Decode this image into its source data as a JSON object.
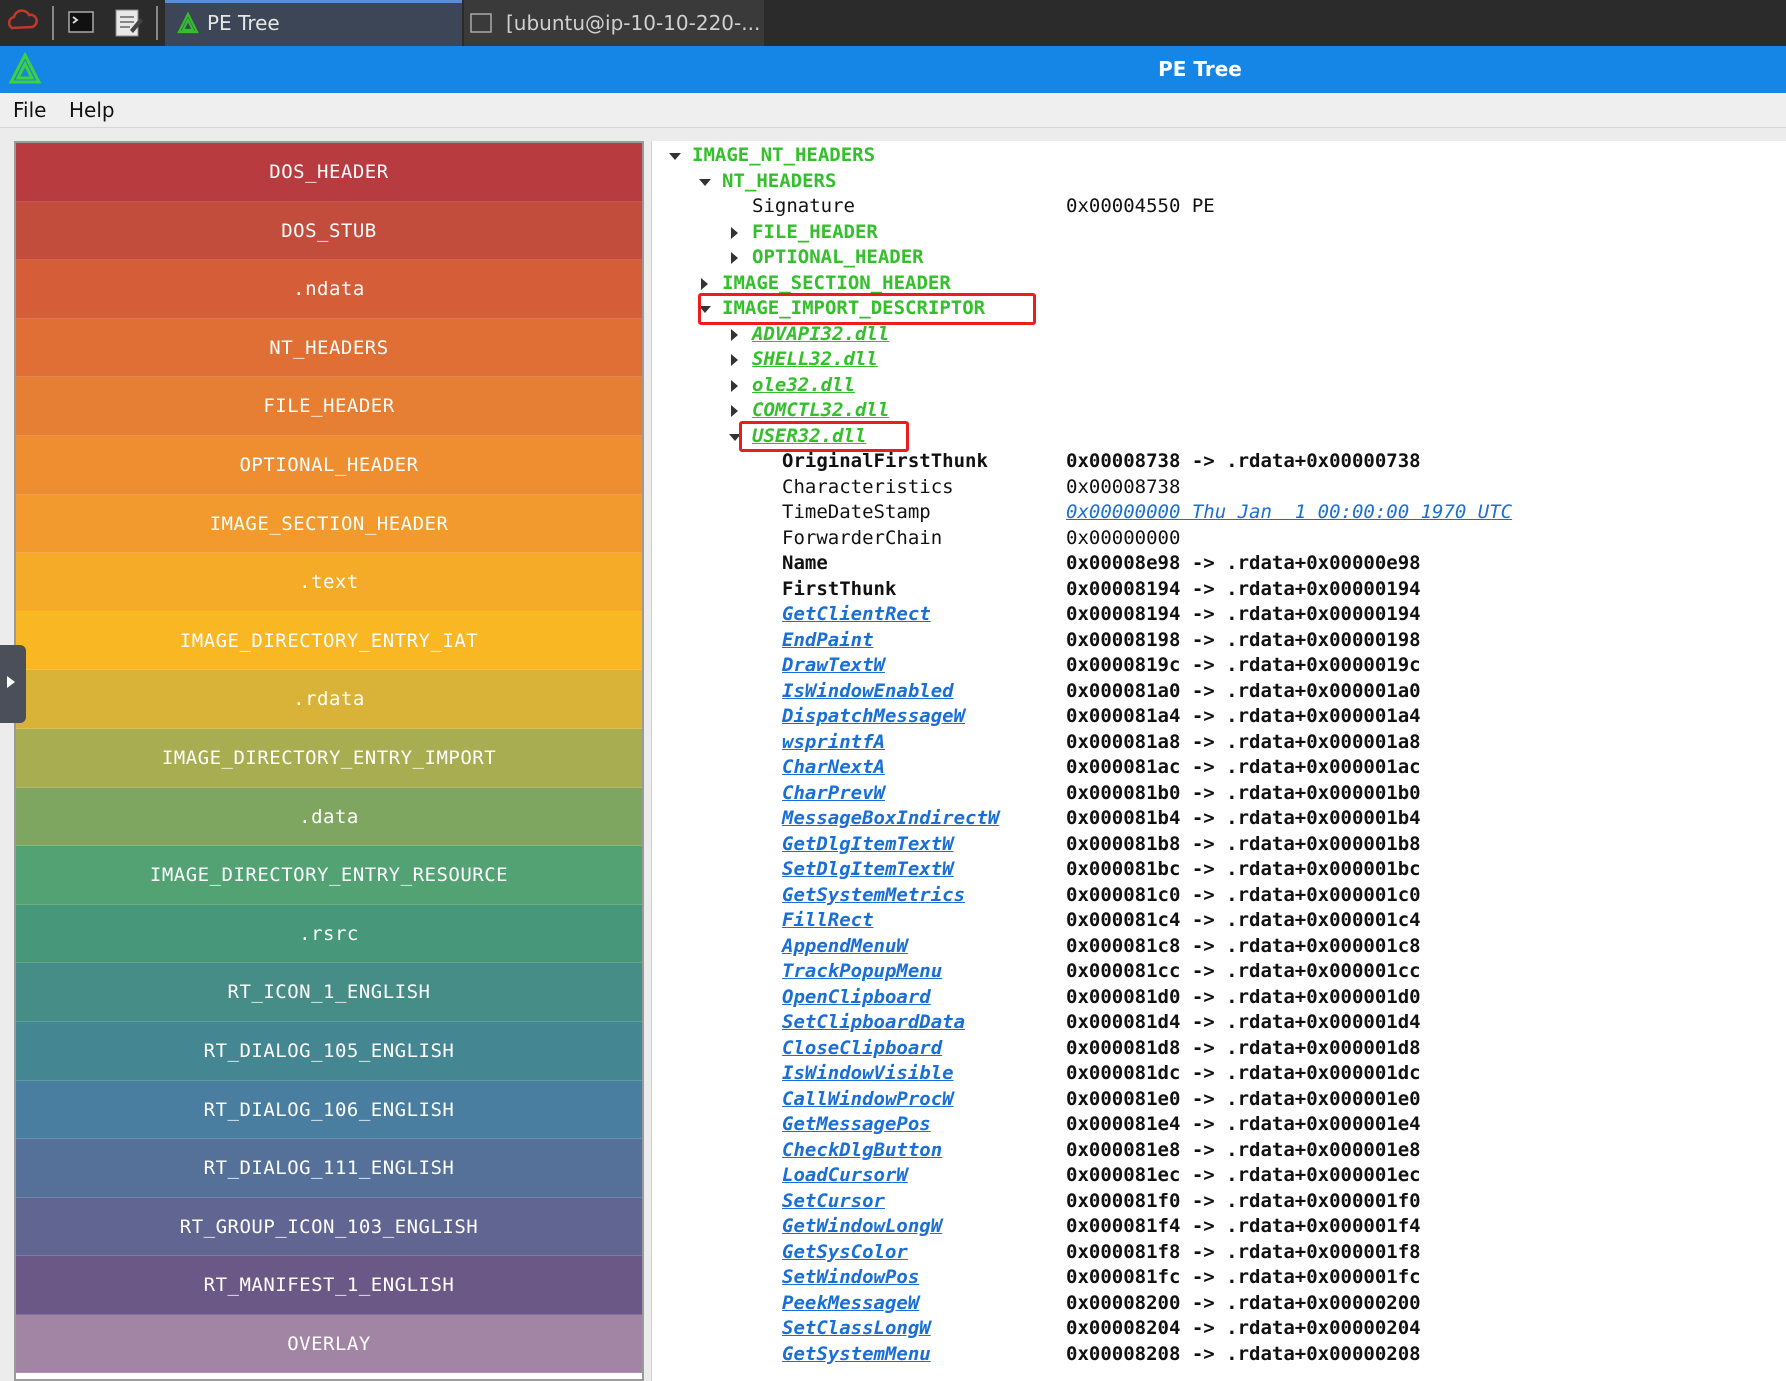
{
  "taskbar": {
    "tabs": [
      {
        "label": "PE Tree"
      },
      {
        "label": "[ubuntu@ip-10-10-220-..."
      }
    ]
  },
  "window": {
    "title": "PE Tree"
  },
  "menu": [
    {
      "label": "File"
    },
    {
      "label": "Help"
    }
  ],
  "sections": [
    {
      "label": "DOS_HEADER",
      "color": "#b83b40"
    },
    {
      "label": "DOS_STUB",
      "color": "#c24d3c"
    },
    {
      "label": ".ndata",
      "color": "#d55d38"
    },
    {
      "label": "NT_HEADERS",
      "color": "#df6f35"
    },
    {
      "label": "FILE_HEADER",
      "color": "#e67f33"
    },
    {
      "label": "OPTIONAL_HEADER",
      "color": "#ee8e30"
    },
    {
      "label": "IMAGE_SECTION_HEADER",
      "color": "#f29a2d"
    },
    {
      "label": ".text",
      "color": "#f6ab28"
    },
    {
      "label": "IMAGE_DIRECTORY_ENTRY_IAT",
      "color": "#f8b723"
    },
    {
      "label": ".rdata",
      "color": "#d8b338"
    },
    {
      "label": "IMAGE_DIRECTORY_ENTRY_IMPORT",
      "color": "#a9ad52"
    },
    {
      "label": ".data",
      "color": "#7fa661"
    },
    {
      "label": "IMAGE_DIRECTORY_ENTRY_RESOURCE",
      "color": "#52a274"
    },
    {
      "label": ".rsrc",
      "color": "#47977b"
    },
    {
      "label": "RT_ICON_1_ENGLISH",
      "color": "#458d86"
    },
    {
      "label": "RT_DIALOG_105_ENGLISH",
      "color": "#458693"
    },
    {
      "label": "RT_DIALOG_106_ENGLISH",
      "color": "#4a7ea0"
    },
    {
      "label": "RT_DIALOG_111_ENGLISH",
      "color": "#55719a"
    },
    {
      "label": "RT_GROUP_ICON_103_ENGLISH",
      "color": "#616592"
    },
    {
      "label": "RT_MANIFEST_1_ENGLISH",
      "color": "#6c5886"
    },
    {
      "label": "OVERLAY",
      "color": "#a284a4"
    }
  ],
  "tree": {
    "headers": [
      {
        "label": "IMAGE_NT_HEADERS",
        "level": 0,
        "twisty": "down",
        "style": "green"
      },
      {
        "label": "NT_HEADERS",
        "level": 1,
        "twisty": "down",
        "style": "green"
      },
      {
        "label": "Signature",
        "level": 2,
        "twisty": "",
        "style": "normal",
        "value": "0x00004550 PE",
        "value_style": "normal"
      },
      {
        "label": "FILE_HEADER",
        "level": 2,
        "twisty": "right",
        "style": "green"
      },
      {
        "label": "OPTIONAL_HEADER",
        "level": 2,
        "twisty": "right",
        "style": "green"
      },
      {
        "label": "IMAGE_SECTION_HEADER",
        "level": 1,
        "twisty": "right",
        "style": "green"
      },
      {
        "label": "IMAGE_IMPORT_DESCRIPTOR",
        "level": 1,
        "twisty": "down",
        "style": "green"
      },
      {
        "label": "ADVAPI32.dll",
        "level": 2,
        "twisty": "right",
        "style": "green-link"
      },
      {
        "label": "SHELL32.dll",
        "level": 2,
        "twisty": "right",
        "style": "green-link"
      },
      {
        "label": "ole32.dll",
        "level": 2,
        "twisty": "right",
        "style": "green-link"
      },
      {
        "label": "COMCTL32.dll",
        "level": 2,
        "twisty": "right",
        "style": "green-link"
      },
      {
        "label": "USER32.dll",
        "level": 2,
        "twisty": "down",
        "style": "green-link"
      }
    ],
    "fields": [
      {
        "label": "OriginalFirstThunk",
        "style": "bold",
        "value": "0x00008738 -> .rdata+0x00000738",
        "value_style": "bold"
      },
      {
        "label": "Characteristics",
        "style": "normal",
        "value": "0x00008738",
        "value_style": "normal"
      },
      {
        "label": "TimeDateStamp",
        "style": "normal",
        "value": "0x00000000 Thu Jan  1 00:00:00 1970 UTC",
        "value_style": "val-link"
      },
      {
        "label": "ForwarderChain",
        "style": "normal",
        "value": "0x00000000",
        "value_style": "normal"
      },
      {
        "label": "Name",
        "style": "bold",
        "value": "0x00008e98 -> .rdata+0x00000e98",
        "value_style": "bold"
      },
      {
        "label": "FirstThunk",
        "style": "bold",
        "value": "0x00008194 -> .rdata+0x00000194",
        "value_style": "bold"
      }
    ],
    "imports": [
      {
        "name": "GetClientRect",
        "value": "0x00008194 -> .rdata+0x00000194"
      },
      {
        "name": "EndPaint",
        "value": "0x00008198 -> .rdata+0x00000198"
      },
      {
        "name": "DrawTextW",
        "value": "0x0000819c -> .rdata+0x0000019c"
      },
      {
        "name": "IsWindowEnabled",
        "value": "0x000081a0 -> .rdata+0x000001a0"
      },
      {
        "name": "DispatchMessageW",
        "value": "0x000081a4 -> .rdata+0x000001a4"
      },
      {
        "name": "wsprintfA",
        "value": "0x000081a8 -> .rdata+0x000001a8"
      },
      {
        "name": "CharNextA",
        "value": "0x000081ac -> .rdata+0x000001ac"
      },
      {
        "name": "CharPrevW",
        "value": "0x000081b0 -> .rdata+0x000001b0"
      },
      {
        "name": "MessageBoxIndirectW",
        "value": "0x000081b4 -> .rdata+0x000001b4"
      },
      {
        "name": "GetDlgItemTextW",
        "value": "0x000081b8 -> .rdata+0x000001b8"
      },
      {
        "name": "SetDlgItemTextW",
        "value": "0x000081bc -> .rdata+0x000001bc"
      },
      {
        "name": "GetSystemMetrics",
        "value": "0x000081c0 -> .rdata+0x000001c0"
      },
      {
        "name": "FillRect",
        "value": "0x000081c4 -> .rdata+0x000001c4"
      },
      {
        "name": "AppendMenuW",
        "value": "0x000081c8 -> .rdata+0x000001c8"
      },
      {
        "name": "TrackPopupMenu",
        "value": "0x000081cc -> .rdata+0x000001cc"
      },
      {
        "name": "OpenClipboard",
        "value": "0x000081d0 -> .rdata+0x000001d0"
      },
      {
        "name": "SetClipboardData",
        "value": "0x000081d4 -> .rdata+0x000001d4"
      },
      {
        "name": "CloseClipboard",
        "value": "0x000081d8 -> .rdata+0x000001d8"
      },
      {
        "name": "IsWindowVisible",
        "value": "0x000081dc -> .rdata+0x000001dc"
      },
      {
        "name": "CallWindowProcW",
        "value": "0x000081e0 -> .rdata+0x000001e0"
      },
      {
        "name": "GetMessagePos",
        "value": "0x000081e4 -> .rdata+0x000001e4"
      },
      {
        "name": "CheckDlgButton",
        "value": "0x000081e8 -> .rdata+0x000001e8"
      },
      {
        "name": "LoadCursorW",
        "value": "0x000081ec -> .rdata+0x000001ec"
      },
      {
        "name": "SetCursor",
        "value": "0x000081f0 -> .rdata+0x000001f0"
      },
      {
        "name": "GetWindowLongW",
        "value": "0x000081f4 -> .rdata+0x000001f4"
      },
      {
        "name": "GetSysColor",
        "value": "0x000081f8 -> .rdata+0x000001f8"
      },
      {
        "name": "SetWindowPos",
        "value": "0x000081fc -> .rdata+0x000001fc"
      },
      {
        "name": "PeekMessageW",
        "value": "0x00008200 -> .rdata+0x00000200"
      },
      {
        "name": "SetClassLongW",
        "value": "0x00008204 -> .rdata+0x00000204"
      },
      {
        "name": "GetSystemMenu",
        "value": "0x00008208 -> .rdata+0x00000208"
      }
    ]
  }
}
